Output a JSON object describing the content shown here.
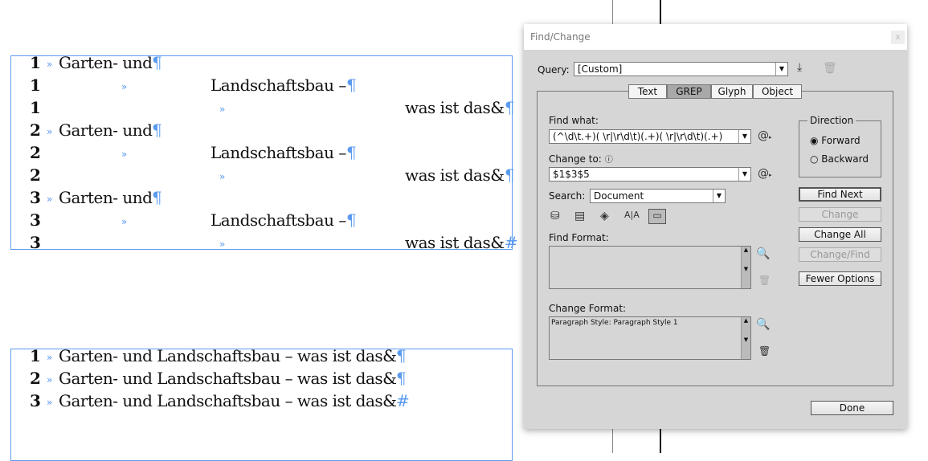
{
  "document": {
    "frame1_lines": [
      {
        "num": "1",
        "text": "Garten- und",
        "col": 1,
        "end": "¶"
      },
      {
        "num": "1",
        "text": "Landschaftsbau –",
        "col": 2,
        "end": "¶"
      },
      {
        "num": "1",
        "text": "was ist das&",
        "col": 3,
        "end": "¶"
      },
      {
        "num": "2",
        "text": "Garten- und",
        "col": 1,
        "end": "¶"
      },
      {
        "num": "2",
        "text": "Landschaftsbau –",
        "col": 2,
        "end": "¶"
      },
      {
        "num": "2",
        "text": "was ist das&",
        "col": 3,
        "end": "¶"
      },
      {
        "num": "3",
        "text": "Garten- und",
        "col": 1,
        "end": "¶"
      },
      {
        "num": "3",
        "text": "Landschaftsbau –",
        "col": 2,
        "end": "¶"
      },
      {
        "num": "3",
        "text": "was ist das&",
        "col": 3,
        "end": "#"
      }
    ],
    "frame2_lines": [
      {
        "num": "1",
        "text": "Garten- und Landschaftsbau – was ist das&",
        "end": "¶"
      },
      {
        "num": "2",
        "text": "Garten- und Landschaftsbau – was ist das&",
        "end": "¶"
      },
      {
        "num": "3",
        "text": "Garten- und Landschaftsbau – was ist das&",
        "end": "#"
      }
    ],
    "tab_marker": "»"
  },
  "dialog": {
    "title": "Find/Change",
    "close": "x",
    "query_label": "Query:",
    "query_value": "[Custom]",
    "tabs": [
      "Text",
      "GREP",
      "Glyph",
      "Object"
    ],
    "active_tab": "GREP",
    "find_label": "Find what:",
    "find_value": "(^\\d\\t.+)( \\r|\\r\\d\\t)(.+)( \\r|\\r\\d\\t)(.+)",
    "change_label": "Change to:",
    "change_value": "$1$3$5",
    "search_label": "Search:",
    "search_value": "Document",
    "direction_label": "Direction",
    "forward": "Forward",
    "backward": "Backward",
    "buttons": {
      "find_next": "Find Next",
      "change": "Change",
      "change_all": "Change All",
      "change_find": "Change/Find",
      "fewer": "Fewer Options",
      "done": "Done"
    },
    "find_format_label": "Find Format:",
    "find_format_value": "",
    "change_format_label": "Change Format:",
    "change_format_value": "Paragraph Style: Paragraph Style 1"
  }
}
